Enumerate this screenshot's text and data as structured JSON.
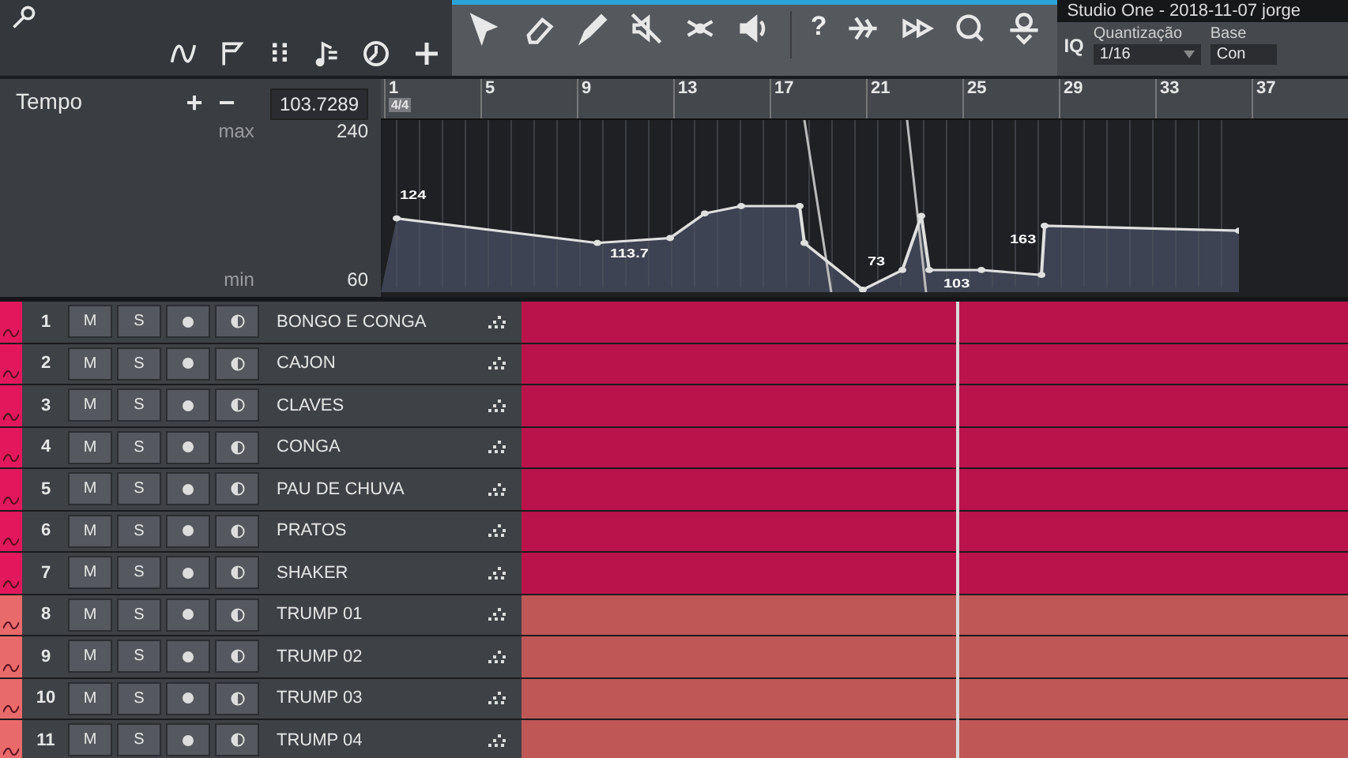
{
  "window": {
    "title": "Studio One - 2018-11-07 jorge"
  },
  "toolbar": {
    "help_label": "?",
    "iq_label": "IQ",
    "quantize": {
      "label": "Quantização",
      "value": "1/16"
    },
    "base": {
      "label": "Base",
      "value": "Con"
    }
  },
  "tempo_panel": {
    "title": "Tempo",
    "plus": "+",
    "minus": "−",
    "value": "103.7289",
    "max_label": "max",
    "max_value": "240",
    "min_label": "min",
    "min_value": "60"
  },
  "ruler": {
    "time_signature": "4/4",
    "bars": [
      "1",
      "5",
      "9",
      "13",
      "17",
      "21",
      "25",
      "29",
      "33",
      "37"
    ]
  },
  "tempo_track": {
    "point_labels": [
      "124",
      "113.7",
      "73",
      "103",
      "163"
    ]
  },
  "tracks": [
    {
      "number": "1",
      "mute": "M",
      "solo": "S",
      "name": "BONGO E CONGA",
      "color": "#e3175c"
    },
    {
      "number": "2",
      "mute": "M",
      "solo": "S",
      "name": "CAJON",
      "color": "#e3175c"
    },
    {
      "number": "3",
      "mute": "M",
      "solo": "S",
      "name": "CLAVES",
      "color": "#e3175c"
    },
    {
      "number": "4",
      "mute": "M",
      "solo": "S",
      "name": "CONGA",
      "color": "#e3175c"
    },
    {
      "number": "5",
      "mute": "M",
      "solo": "S",
      "name": "PAU DE CHUVA",
      "color": "#e3175c"
    },
    {
      "number": "6",
      "mute": "M",
      "solo": "S",
      "name": "PRATOS",
      "color": "#e3175c"
    },
    {
      "number": "7",
      "mute": "M",
      "solo": "S",
      "name": "SHAKER",
      "color": "#e3175c"
    },
    {
      "number": "8",
      "mute": "M",
      "solo": "S",
      "name": "TRUMP 01",
      "color": "#e96a6a"
    },
    {
      "number": "9",
      "mute": "M",
      "solo": "S",
      "name": "TRUMP 02",
      "color": "#e96a6a"
    },
    {
      "number": "10",
      "mute": "M",
      "solo": "S",
      "name": "TRUMP 03",
      "color": "#e96a6a"
    },
    {
      "number": "11",
      "mute": "M",
      "solo": "S",
      "name": "TRUMP 04",
      "color": "#e96a6a"
    }
  ]
}
